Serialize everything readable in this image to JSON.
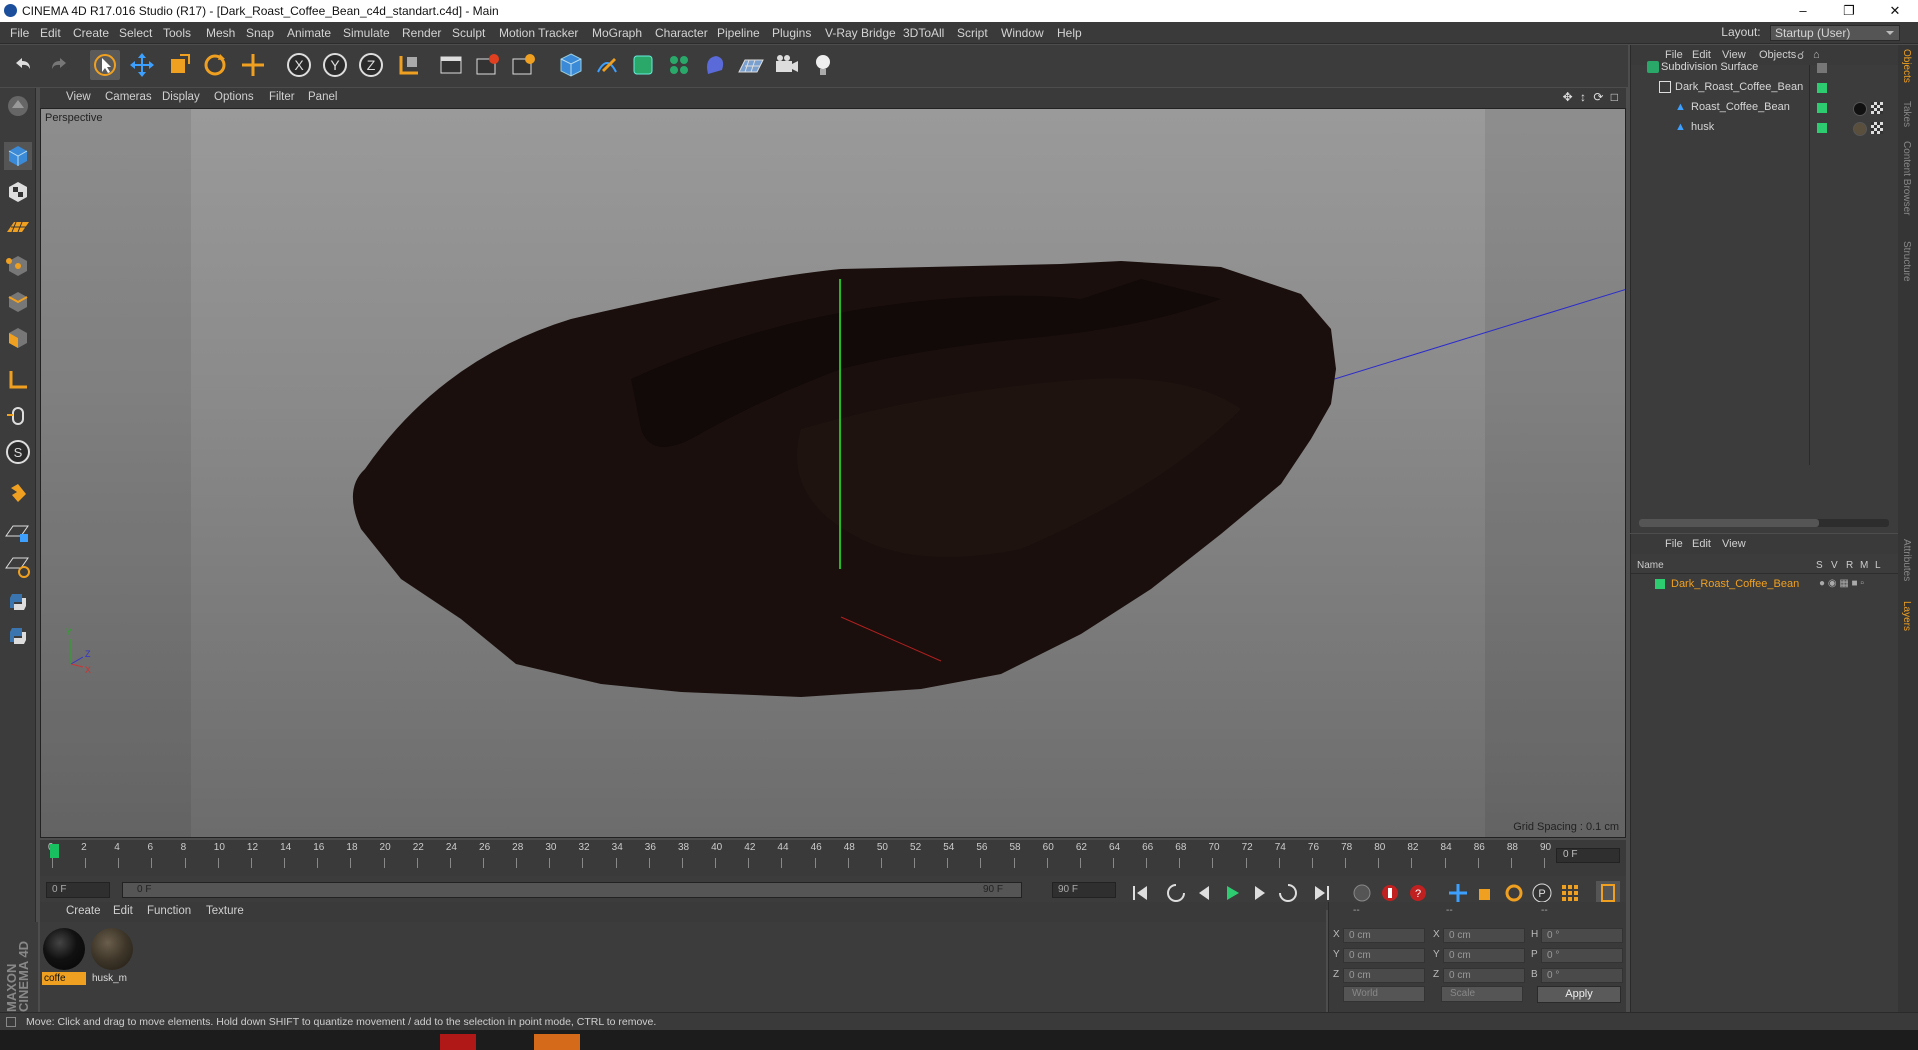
{
  "window": {
    "title": "CINEMA 4D R17.016 Studio (R17) - [Dark_Roast_Coffee_Bean_c4d_standart.c4d] - Main"
  },
  "menubar": {
    "items": [
      "File",
      "Edit",
      "Create",
      "Select",
      "Tools",
      "Mesh",
      "Snap",
      "Animate",
      "Simulate",
      "Render",
      "Sculpt",
      "Motion Tracker",
      "MoGraph",
      "Character",
      "Pipeline",
      "Plugins",
      "V-Ray Bridge",
      "3DToAll",
      "Script",
      "Window",
      "Help"
    ],
    "layout_label": "Layout:",
    "layout_value": "Startup (User)"
  },
  "toolbar": {
    "icons": [
      "undo-icon",
      "redo-icon",
      "select-icon",
      "move-icon",
      "scale-icon",
      "rotate-icon",
      "last-tool-icon",
      "x-axis-icon",
      "y-axis-icon",
      "z-axis-icon",
      "coordinate-system-icon",
      "render-view-icon",
      "render-picture-icon",
      "render-settings-icon",
      "cube-icon",
      "pen-icon",
      "subdivision-icon",
      "cloner-icon",
      "deformer-icon",
      "floor-icon",
      "camera-icon",
      "light-icon"
    ]
  },
  "viewport": {
    "menu": [
      "View",
      "Cameras",
      "Display",
      "Options",
      "Filter",
      "Panel"
    ],
    "label": "Perspective",
    "grid_spacing": "Grid Spacing : 0.1 cm",
    "axis_labels": {
      "y": "Y",
      "z": "Z",
      "x": "X"
    }
  },
  "timeline": {
    "ticks": [
      "0",
      "2",
      "4",
      "6",
      "8",
      "10",
      "12",
      "14",
      "16",
      "18",
      "20",
      "22",
      "24",
      "26",
      "28",
      "30",
      "32",
      "34",
      "36",
      "38",
      "40",
      "42",
      "44",
      "46",
      "48",
      "50",
      "52",
      "54",
      "56",
      "58",
      "60",
      "62",
      "64",
      "66",
      "68",
      "70",
      "72",
      "74",
      "76",
      "78",
      "80",
      "82",
      "84",
      "86",
      "88",
      "90"
    ],
    "current_frame": "0 F"
  },
  "playbar": {
    "start_field": "0 F",
    "range_start": "0 F",
    "range_end": "90 F",
    "end_field": "90 F"
  },
  "materials": {
    "menu": [
      "Create",
      "Edit",
      "Function",
      "Texture"
    ],
    "items": [
      {
        "name": "coffe",
        "selected": true,
        "color": "#111111"
      },
      {
        "name": "husk_m",
        "selected": false,
        "color": "#3d3528"
      }
    ]
  },
  "coordinates": {
    "headers": [
      "--",
      "--",
      "--"
    ],
    "rows": [
      {
        "a": "X",
        "av": "0 cm",
        "b": "X",
        "bv": "0 cm",
        "c": "H",
        "cv": "0 °"
      },
      {
        "a": "Y",
        "av": "0 cm",
        "b": "Y",
        "bv": "0 cm",
        "c": "P",
        "cv": "0 °"
      },
      {
        "a": "Z",
        "av": "0 cm",
        "b": "Z",
        "bv": "0 cm",
        "c": "B",
        "cv": "0 °"
      }
    ],
    "mode1": "World",
    "mode2": "Scale",
    "apply": "Apply"
  },
  "objects": {
    "menu": [
      "File",
      "Edit",
      "View",
      "Objects"
    ],
    "items": [
      {
        "name": "Subdivision Surface",
        "level": 0
      },
      {
        "name": "Dark_Roast_Coffee_Bean",
        "level": 1
      },
      {
        "name": "Roast_Coffee_Bean",
        "level": 2
      },
      {
        "name": "husk",
        "level": 2
      }
    ]
  },
  "layers": {
    "menu": [
      "File",
      "Edit",
      "View"
    ],
    "columns": [
      "Name",
      "S",
      "V",
      "R",
      "M",
      "L"
    ],
    "items": [
      {
        "name": "Dark_Roast_Coffee_Bean",
        "color": "#2ecc71"
      }
    ]
  },
  "right_tabs": [
    "Objects",
    "Takes",
    "Content Browser",
    "Structure",
    "Attributes",
    "Layers"
  ],
  "status": {
    "text": "Move: Click and drag to move elements. Hold down SHIFT to quantize movement / add to the selection in point mode, CTRL to remove."
  },
  "brand": "MAXON CINEMA 4D",
  "colors": {
    "accent": "#f0a020",
    "object_green": "#2ecc71",
    "axis_green": "#22bb22",
    "axis_blue": "#2a2acc",
    "axis_red": "#cc2222"
  }
}
